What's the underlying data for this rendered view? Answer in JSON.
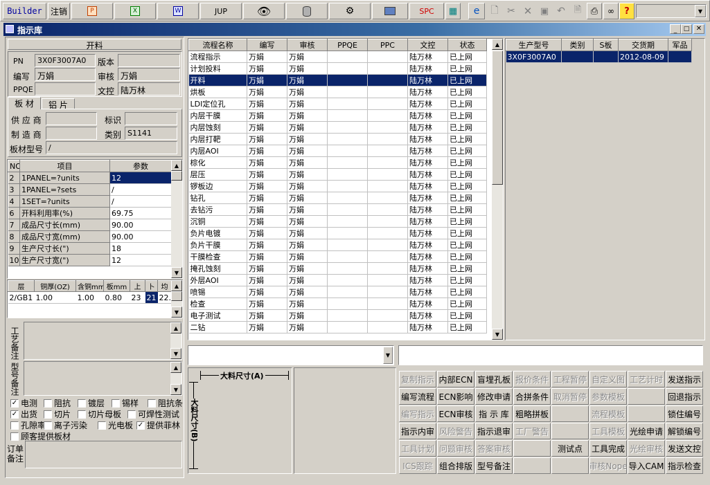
{
  "toolbar": {
    "builder": "Builder",
    "logout": "注销",
    "jup": "JUP",
    "spc": "SPC"
  },
  "window": {
    "title": "指示库"
  },
  "left": {
    "section_title": "开料",
    "pn_label": "PN",
    "pn_value": "3X0F3007A0",
    "version_label": "版本",
    "version_value": "",
    "writer_label": "编写",
    "writer_value": "万娟",
    "reviewer_label": "审核",
    "reviewer_value": "万娟",
    "ppqe_label": "PPQE",
    "ppqe_value": "",
    "doc_label": "文控",
    "doc_value": "陆万林",
    "tab_board": "板 材",
    "tab_foil": "铝 片",
    "supplier_label": "供 应 商",
    "supplier_value": "",
    "mark_label": "标识",
    "mark_value": "",
    "maker_label": "制 造 商",
    "maker_value": "",
    "category_label": "类别",
    "category_value": "S1141",
    "board_type_label": "板材型号",
    "board_type_value": "/",
    "param_headers": [
      "NO",
      "项目",
      "参数"
    ],
    "params": [
      [
        "2",
        "1PANEL=?units",
        "12"
      ],
      [
        "3",
        "1PANEL=?sets",
        "/"
      ],
      [
        "4",
        "1SET=?units",
        "/"
      ],
      [
        "6",
        "开料利用率(%)",
        "69.75"
      ],
      [
        "7",
        "成品尺寸长(mm)",
        "90.00"
      ],
      [
        "8",
        "成品尺寸宽(mm)",
        "90.00"
      ],
      [
        "9",
        "生产尺寸长(\")",
        "18"
      ],
      [
        "10",
        "生产尺寸宽(\")",
        "12"
      ]
    ],
    "layer_headers": [
      "层",
      "铜厚(OZ)",
      "含铜mm",
      "板mm",
      "上",
      "卜",
      "均"
    ],
    "layer_row": [
      "2/GB1",
      "1.00",
      "1.00",
      "0.80",
      "23",
      "21",
      "22."
    ],
    "craft_note_label": "工艺备注",
    "model_note_label": "型号备注",
    "checks": [
      [
        "电测",
        true
      ],
      [
        "阻抗",
        false
      ],
      [
        "镀层",
        false
      ],
      [
        "锡样",
        false
      ],
      [
        "阻抗条",
        false
      ],
      [
        "出货",
        true
      ],
      [
        "切片",
        false
      ],
      [
        "切片母板",
        false
      ],
      [
        "可焊性测试",
        false
      ],
      [
        "孔隙率",
        false
      ],
      [
        "离子污染",
        false
      ],
      [
        "光电板",
        false
      ],
      [
        "提供菲林",
        true
      ],
      [
        "顾客提供板材",
        false
      ]
    ],
    "order_note_label": "订单备注"
  },
  "process": {
    "headers": [
      "流程名称",
      "编写",
      "审核",
      "PPQE",
      "PPC",
      "文控",
      "状态"
    ],
    "rows": [
      [
        "流程指示",
        "万娟",
        "万娟",
        "",
        "",
        "陆万林",
        "已上网"
      ],
      [
        "计划投料",
        "万娟",
        "万娟",
        "",
        "",
        "陆万林",
        "已上网"
      ],
      [
        "开料",
        "万娟",
        "万娟",
        "",
        "",
        "陆万林",
        "已上网"
      ],
      [
        "烘板",
        "万娟",
        "万娟",
        "",
        "",
        "陆万林",
        "已上网"
      ],
      [
        "LDI定位孔",
        "万娟",
        "万娟",
        "",
        "",
        "陆万林",
        "已上网"
      ],
      [
        "内层干膜",
        "万娟",
        "万娟",
        "",
        "",
        "陆万林",
        "已上网"
      ],
      [
        "内层蚀刻",
        "万娟",
        "万娟",
        "",
        "",
        "陆万林",
        "已上网"
      ],
      [
        "内层打靶",
        "万娟",
        "万娟",
        "",
        "",
        "陆万林",
        "已上网"
      ],
      [
        "内层AOI",
        "万娟",
        "万娟",
        "",
        "",
        "陆万林",
        "已上网"
      ],
      [
        "棕化",
        "万娟",
        "万娟",
        "",
        "",
        "陆万林",
        "已上网"
      ],
      [
        "层压",
        "万娟",
        "万娟",
        "",
        "",
        "陆万林",
        "已上网"
      ],
      [
        "锣板边",
        "万娟",
        "万娟",
        "",
        "",
        "陆万林",
        "已上网"
      ],
      [
        "钻孔",
        "万娟",
        "万娟",
        "",
        "",
        "陆万林",
        "已上网"
      ],
      [
        "去钻污",
        "万娟",
        "万娟",
        "",
        "",
        "陆万林",
        "已上网"
      ],
      [
        "沉铜",
        "万娟",
        "万娟",
        "",
        "",
        "陆万林",
        "已上网"
      ],
      [
        "负片电镀",
        "万娟",
        "万娟",
        "",
        "",
        "陆万林",
        "已上网"
      ],
      [
        "负片干膜",
        "万娟",
        "万娟",
        "",
        "",
        "陆万林",
        "已上网"
      ],
      [
        "干膜检查",
        "万娟",
        "万娟",
        "",
        "",
        "陆万林",
        "已上网"
      ],
      [
        "掩孔蚀刻",
        "万娟",
        "万娟",
        "",
        "",
        "陆万林",
        "已上网"
      ],
      [
        "外层AOI",
        "万娟",
        "万娟",
        "",
        "",
        "陆万林",
        "已上网"
      ],
      [
        "喷锡",
        "万娟",
        "万娟",
        "",
        "",
        "陆万林",
        "已上网"
      ],
      [
        "检查",
        "万娟",
        "万娟",
        "",
        "",
        "陆万林",
        "已上网"
      ],
      [
        "电子测试",
        "万娟",
        "万娟",
        "",
        "",
        "陆万林",
        "已上网"
      ],
      [
        "二钻",
        "万娟",
        "万娟",
        "",
        "",
        "陆万林",
        "已上网"
      ]
    ]
  },
  "products": {
    "headers": [
      "生产型号",
      "类别",
      "S板",
      "交货期",
      "军品"
    ],
    "rows": [
      [
        "3X0F3007A0",
        "",
        "",
        "2012-08-09",
        ""
      ]
    ]
  },
  "diagram": {
    "a_label": "大料尺寸(A)",
    "b_label": "大料尺寸(B)"
  },
  "actions": [
    [
      [
        "复制指示",
        false
      ],
      [
        "内部ECN",
        true
      ],
      [
        "盲埋孔板",
        true
      ],
      [
        "报价条件",
        false
      ],
      [
        "工程暂停",
        false
      ],
      [
        "自定义图",
        false
      ],
      [
        "工艺计时",
        false
      ],
      [
        "发送指示",
        true
      ]
    ],
    [
      [
        "编写流程",
        true
      ],
      [
        "ECN影响",
        true
      ],
      [
        "修改申请",
        true
      ],
      [
        "合拼条件",
        true
      ],
      [
        "取消暂停",
        false
      ],
      [
        "参数模板",
        false
      ],
      [
        "",
        false
      ],
      [
        "回退指示",
        true
      ]
    ],
    [
      [
        "编写指示",
        false
      ],
      [
        "ECN审核",
        true
      ],
      [
        "指 示 库",
        true
      ],
      [
        "粗略拼板",
        true
      ],
      [
        "",
        false
      ],
      [
        "流程模板",
        false
      ],
      [
        "",
        false
      ],
      [
        "锁住编号",
        true
      ]
    ],
    [
      [
        "指示内审",
        true
      ],
      [
        "风险警告",
        false
      ],
      [
        "指示退审",
        true
      ],
      [
        "工厂警告",
        false
      ],
      [
        "",
        false
      ],
      [
        "工具模板",
        false
      ],
      [
        "光绘申请",
        true
      ],
      [
        "解锁编号",
        true
      ]
    ],
    [
      [
        "工具计划",
        false
      ],
      [
        "问题审核",
        false
      ],
      [
        "答案审核",
        false
      ],
      [
        "",
        false
      ],
      [
        "测试点",
        true
      ],
      [
        "工具完成",
        true
      ],
      [
        "光绘审核",
        false
      ],
      [
        "发送文控",
        true
      ]
    ],
    [
      [
        "ICS跟踪",
        false
      ],
      [
        "组合排版",
        true
      ],
      [
        "型号备注",
        true
      ],
      [
        "",
        false
      ],
      [
        "",
        false
      ],
      [
        "审核Nope",
        false
      ],
      [
        "导入CAM",
        true
      ],
      [
        "指示检查",
        true
      ]
    ]
  ],
  "colors": {
    "selection": "#0a246a",
    "titlebar": "#0a246a",
    "face": "#d4d0c8"
  }
}
